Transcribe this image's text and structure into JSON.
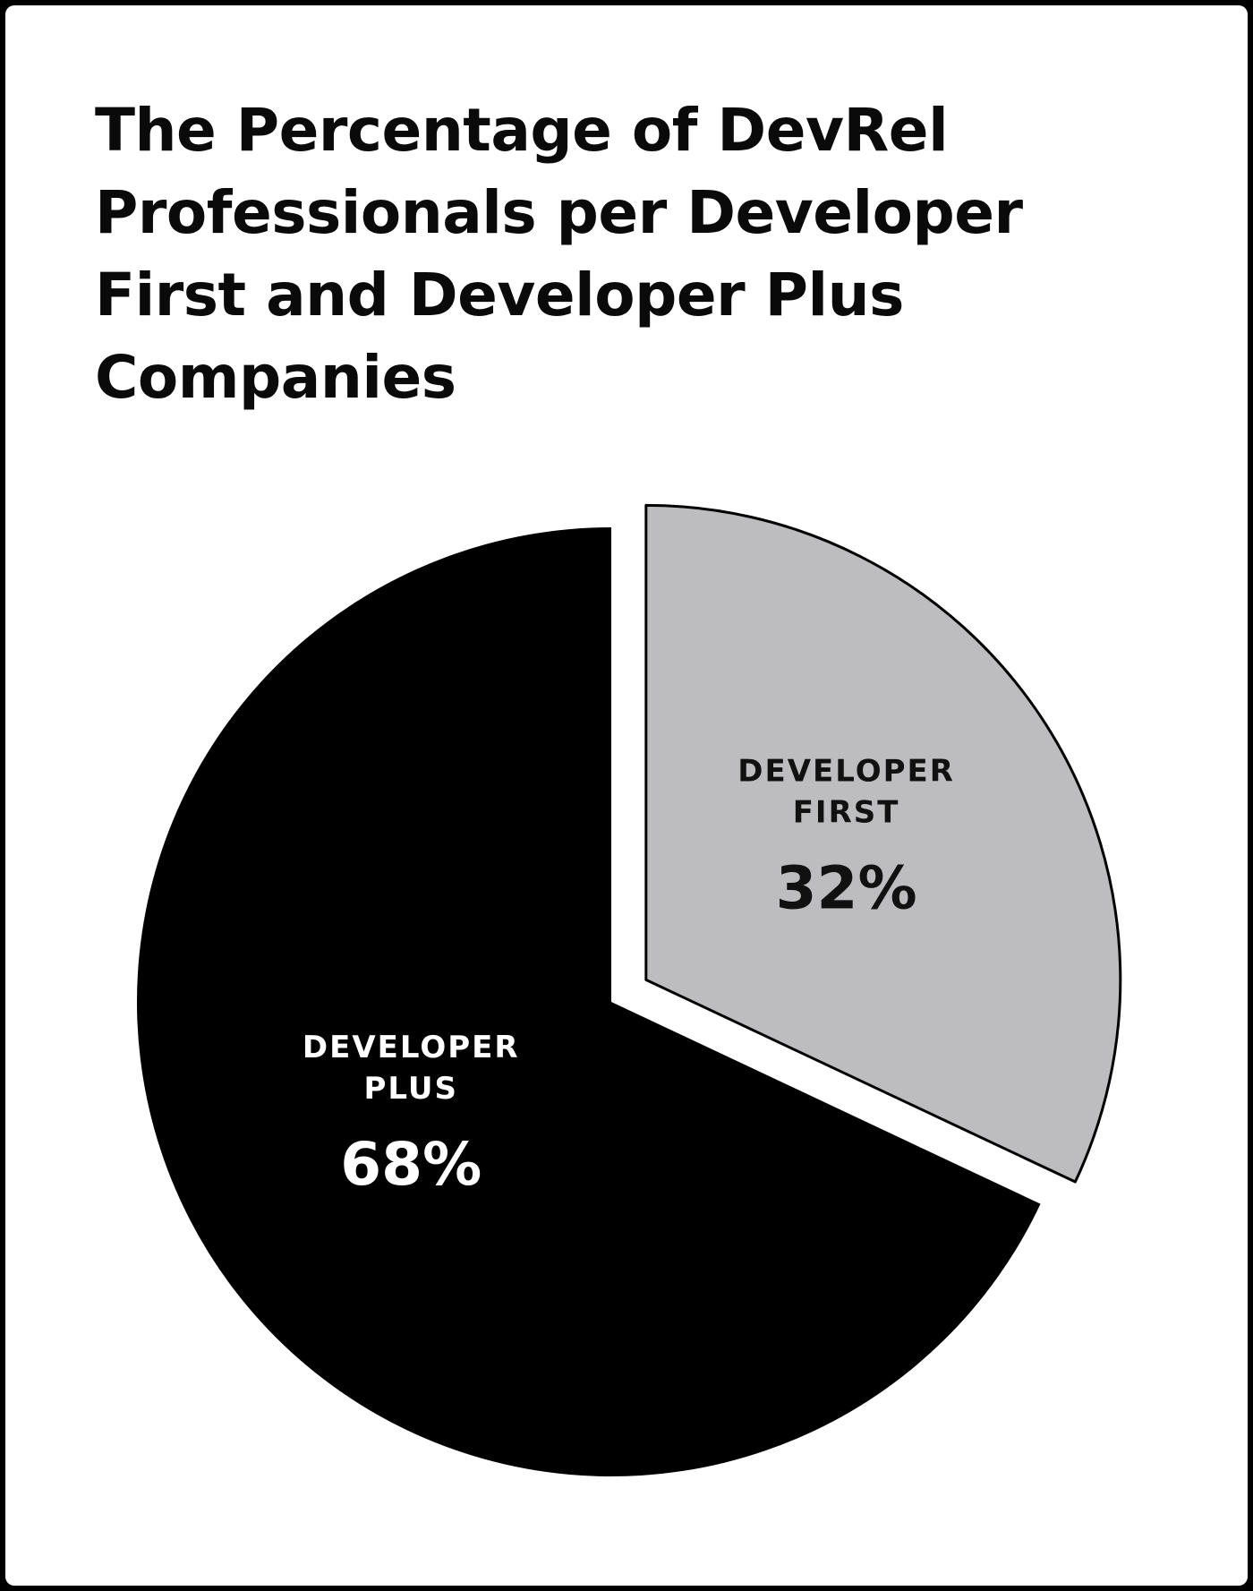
{
  "chart_data": {
    "type": "pie",
    "title_lines": [
      "The Percentage of DevRel",
      "Professionals per Developer",
      "First and Developer Plus",
      "Companies"
    ],
    "slices": [
      {
        "label_lines": [
          "DEVELOPER",
          "FIRST"
        ],
        "value": 32,
        "value_label": "32%",
        "color": "#bdbdbf",
        "label_color": "#111111",
        "exploded": true
      },
      {
        "label_lines": [
          "DEVELOPER",
          "PLUS"
        ],
        "value": 68,
        "value_label": "68%",
        "color": "#000000",
        "label_color": "#ffffff",
        "exploded": false
      }
    ]
  }
}
